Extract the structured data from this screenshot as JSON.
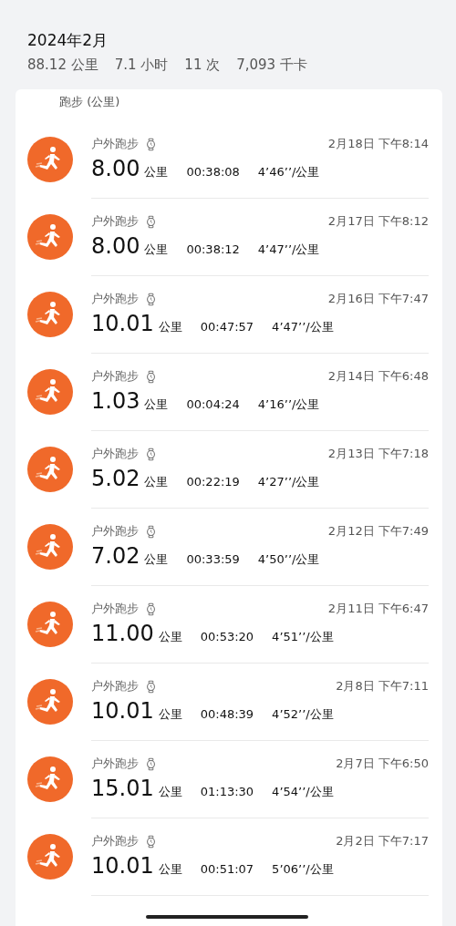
{
  "header": {
    "title": "2024年2月",
    "stats": [
      "88.12 公里",
      "7.1 小时",
      "11 次",
      "7,093 千卡"
    ]
  },
  "section_label": "跑步 (公里)",
  "activities": [
    {
      "type": "户外跑步",
      "date": "2月18日 下午8:14",
      "distance": "8.00",
      "unit": "公里",
      "duration": "00:38:08",
      "pace": "4’46’’/公里"
    },
    {
      "type": "户外跑步",
      "date": "2月17日 下午8:12",
      "distance": "8.00",
      "unit": "公里",
      "duration": "00:38:12",
      "pace": "4’47’’/公里"
    },
    {
      "type": "户外跑步",
      "date": "2月16日 下午7:47",
      "distance": "10.01",
      "unit": "公里",
      "duration": "00:47:57",
      "pace": "4’47’’/公里"
    },
    {
      "type": "户外跑步",
      "date": "2月14日 下午6:48",
      "distance": "1.03",
      "unit": "公里",
      "duration": "00:04:24",
      "pace": "4’16’’/公里"
    },
    {
      "type": "户外跑步",
      "date": "2月13日 下午7:18",
      "distance": "5.02",
      "unit": "公里",
      "duration": "00:22:19",
      "pace": "4’27’’/公里"
    },
    {
      "type": "户外跑步",
      "date": "2月12日 下午7:49",
      "distance": "7.02",
      "unit": "公里",
      "duration": "00:33:59",
      "pace": "4’50’’/公里"
    },
    {
      "type": "户外跑步",
      "date": "2月11日 下午6:47",
      "distance": "11.00",
      "unit": "公里",
      "duration": "00:53:20",
      "pace": "4’51’’/公里"
    },
    {
      "type": "户外跑步",
      "date": "2月8日 下午7:11",
      "distance": "10.01",
      "unit": "公里",
      "duration": "00:48:39",
      "pace": "4’52’’/公里"
    },
    {
      "type": "户外跑步",
      "date": "2月7日 下午6:50",
      "distance": "15.01",
      "unit": "公里",
      "duration": "01:13:30",
      "pace": "4’54’’/公里"
    },
    {
      "type": "户外跑步",
      "date": "2月2日 下午7:17",
      "distance": "10.01",
      "unit": "公里",
      "duration": "00:51:07",
      "pace": "5’06’’/公里"
    }
  ]
}
